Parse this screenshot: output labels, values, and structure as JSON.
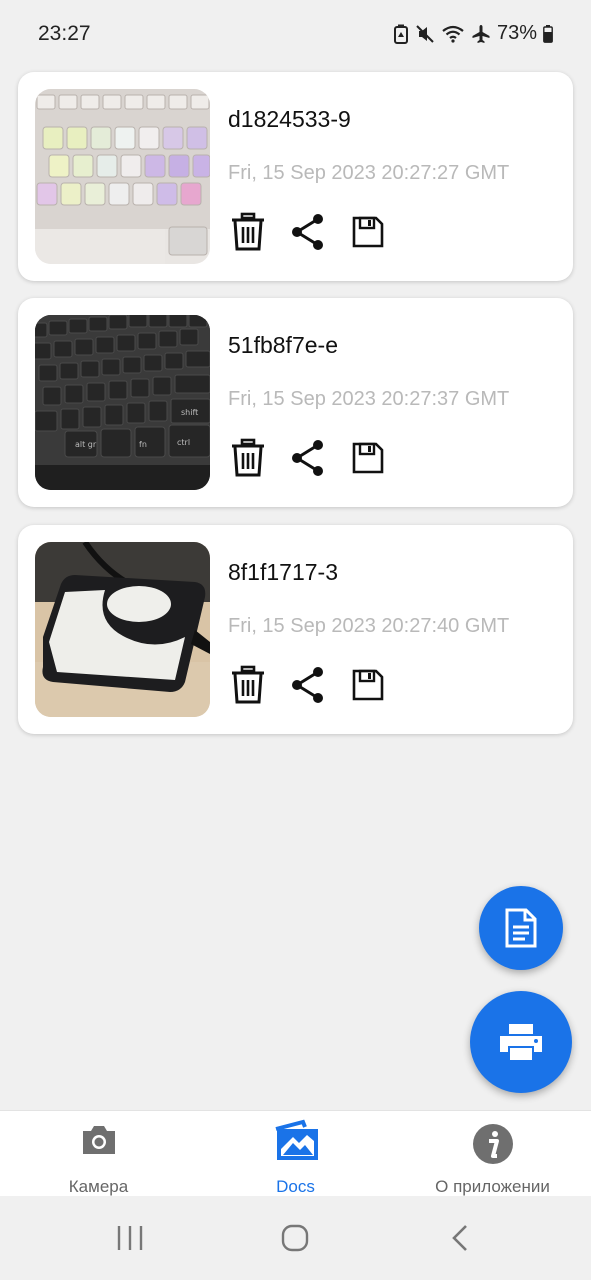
{
  "status": {
    "time": "23:27",
    "battery": "73%"
  },
  "documents": [
    {
      "name": "d1824533-9",
      "date": "Fri, 15 Sep 2023 20:27:27 GMT",
      "thumb": "white-keyboard"
    },
    {
      "name": "51fb8f7e-e",
      "date": "Fri, 15 Sep 2023 20:27:37 GMT",
      "thumb": "dark-keyboard"
    },
    {
      "name": "8f1f1717-3",
      "date": "Fri, 15 Sep 2023 20:27:40 GMT",
      "thumb": "external-drive"
    }
  ],
  "actions": {
    "delete_icon": "trash-icon",
    "share_icon": "share-icon",
    "save_icon": "floppy-save-icon"
  },
  "fab": {
    "docs_icon": "document-icon",
    "print_icon": "printer-icon"
  },
  "nav": {
    "camera_label": "Камера",
    "docs_label": "Docs",
    "about_label": "О приложении"
  },
  "colors": {
    "accent": "#1a73e8",
    "date_text": "#b9b9b9",
    "background": "#f0f0f0"
  }
}
